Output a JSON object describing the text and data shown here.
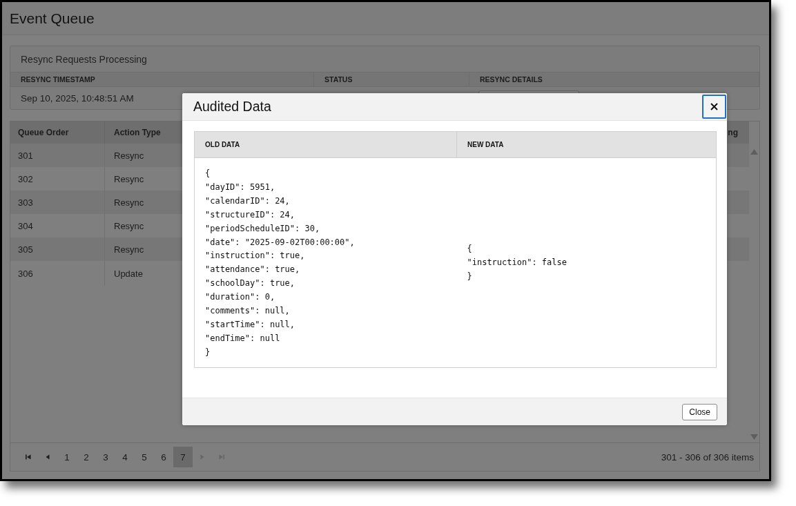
{
  "page": {
    "title": "Event Queue"
  },
  "resync_panel": {
    "title": "Resync Requests Processing",
    "columns": [
      "RESYNC TIMESTAMP",
      "STATUS",
      "RESYNC DETAILS"
    ],
    "rows": [
      {
        "timestamp": "Sep 10, 2025, 10:48:51 AM"
      }
    ]
  },
  "queue_table": {
    "columns": [
      "Queue Order",
      "Action Type",
      "ng"
    ],
    "rows": [
      {
        "queue_order": "301",
        "action_type": "Resync"
      },
      {
        "queue_order": "302",
        "action_type": "Resync"
      },
      {
        "queue_order": "303",
        "action_type": "Resync"
      },
      {
        "queue_order": "304",
        "action_type": "Resync"
      },
      {
        "queue_order": "305",
        "action_type": "Resync"
      },
      {
        "queue_order": "306",
        "action_type": "Update"
      }
    ]
  },
  "pagination": {
    "nav_before": [
      {
        "kind": "first",
        "disabled": false
      },
      {
        "kind": "prev",
        "disabled": false
      }
    ],
    "pages": [
      {
        "label": "1",
        "selected": false
      },
      {
        "label": "2",
        "selected": false
      },
      {
        "label": "3",
        "selected": false
      },
      {
        "label": "4",
        "selected": false
      },
      {
        "label": "5",
        "selected": false
      },
      {
        "label": "6",
        "selected": false
      },
      {
        "label": "7",
        "selected": true
      }
    ],
    "nav_after": [
      {
        "kind": "next",
        "disabled": true
      },
      {
        "kind": "last",
        "disabled": true
      }
    ],
    "summary": "301 - 306 of 306 items"
  },
  "modal": {
    "title": "Audited Data",
    "columns": [
      "OLD DATA",
      "NEW DATA"
    ],
    "old_data": [
      "{",
      "\"dayID\": 5951,",
      "\"calendarID\": 24,",
      "\"structureID\": 24,",
      "\"periodScheduleID\": 30,",
      "\"date\": \"2025-09-02T00:00:00\",",
      "\"instruction\": true,",
      "\"attendance\": true,",
      "\"schoolDay\": true,",
      "\"duration\": 0,",
      "\"comments\": null,",
      "\"startTime\": null,",
      "\"endTime\": null",
      "}"
    ],
    "new_data": [
      "{",
      "\"instruction\": false",
      "}"
    ],
    "footer_button": "Close"
  }
}
